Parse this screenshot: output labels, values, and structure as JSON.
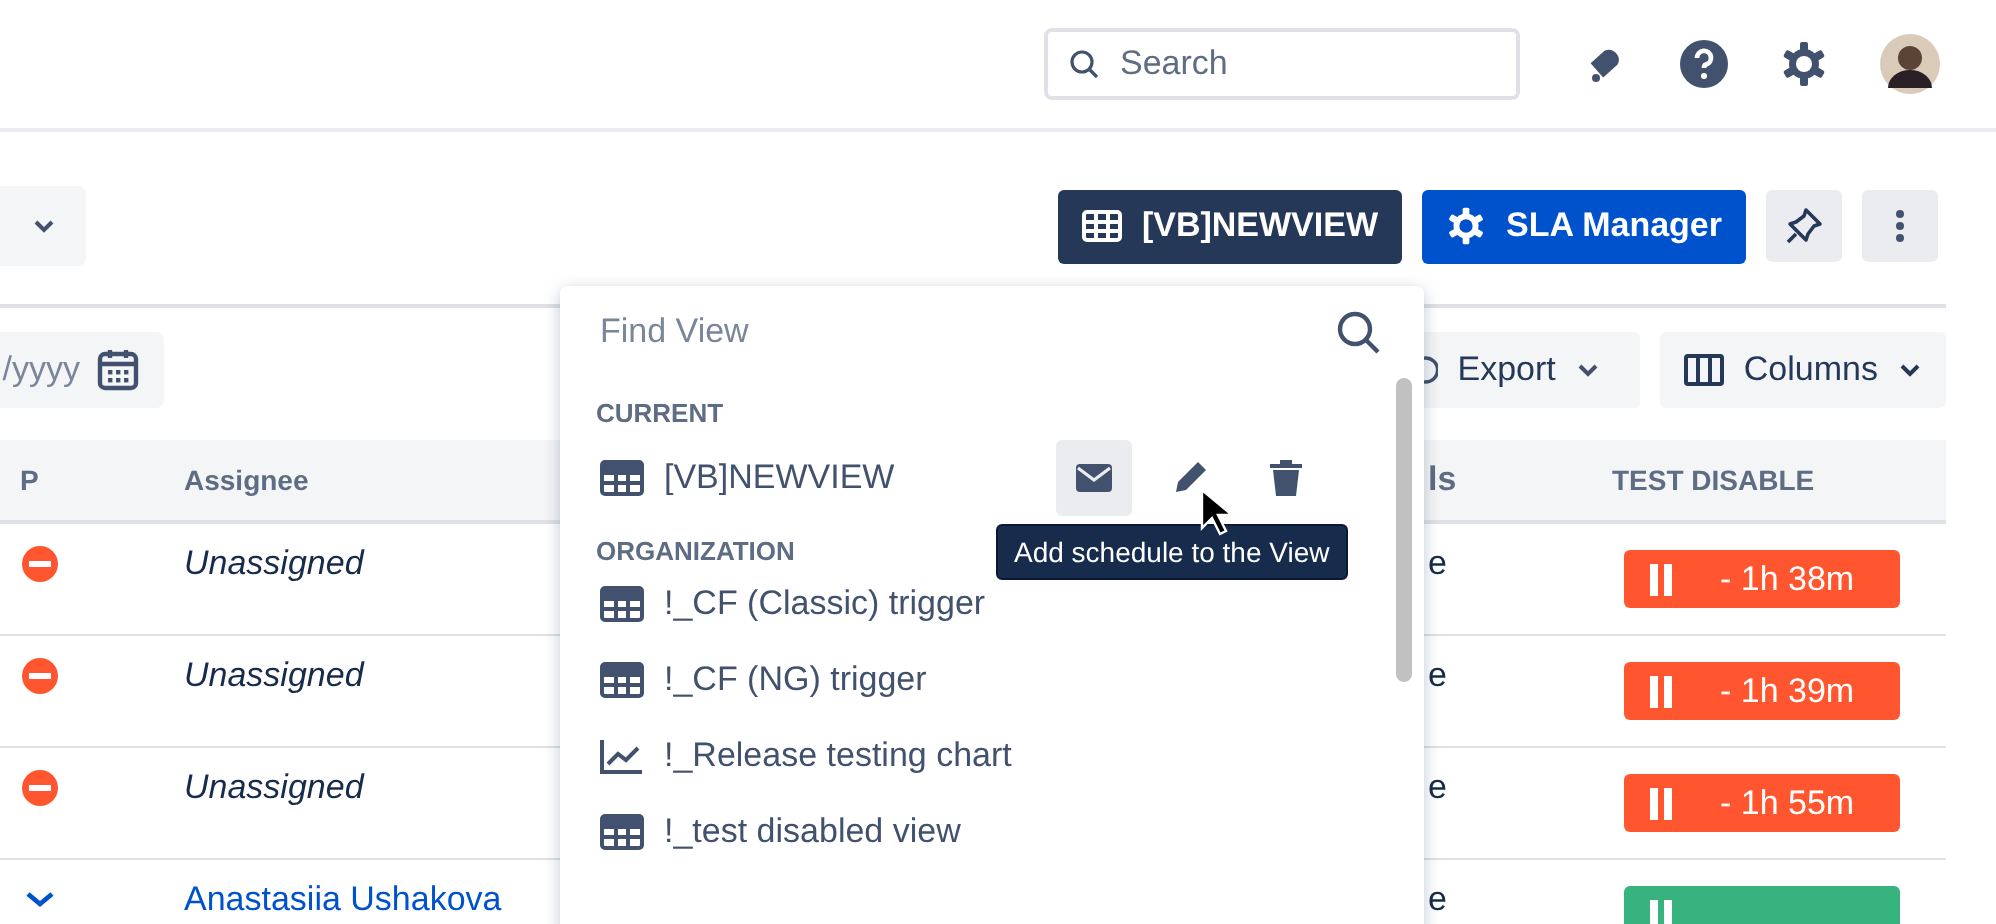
{
  "header": {
    "search": {
      "placeholder": "Search"
    }
  },
  "toolbar": {
    "view_button": "[VB]NEWVIEW",
    "sla_button": "SLA Manager"
  },
  "filters": {
    "date_placeholder": "/yyyy",
    "export_button": "Export",
    "columns_button": "Columns"
  },
  "table": {
    "columns": [
      "P",
      "Assignee",
      "ls",
      "TEST DISABLE"
    ],
    "rows": [
      {
        "assignee": "Unassigned",
        "assigned": false,
        "column_3": "e",
        "sla": "- 1h 38m",
        "color": "#ff5630"
      },
      {
        "assignee": "Unassigned",
        "assigned": false,
        "column_3": "e",
        "sla": "- 1h 39m",
        "color": "#ff5630"
      },
      {
        "assignee": "Unassigned",
        "assigned": false,
        "column_3": "e",
        "sla": "- 1h 55m",
        "color": "#ff5630"
      },
      {
        "assignee": "Anastasiia Ushakova",
        "assigned": true,
        "column_3": "e",
        "sla": "",
        "color": "#36b37e"
      }
    ]
  },
  "view_menu": {
    "placeholder": "Find View",
    "current_heading": "CURRENT",
    "current": {
      "label": "[VB]NEWVIEW",
      "kind": "table"
    },
    "tooltip": "Add schedule to the View",
    "organization_heading": "ORGANIZATION",
    "organization": [
      {
        "label": "!_CF (Classic) trigger",
        "kind": "table"
      },
      {
        "label": "!_CF (NG) trigger",
        "kind": "table"
      },
      {
        "label": "!_Release testing chart",
        "kind": "chart"
      },
      {
        "label": "!_test disabled view",
        "kind": "table"
      }
    ]
  }
}
